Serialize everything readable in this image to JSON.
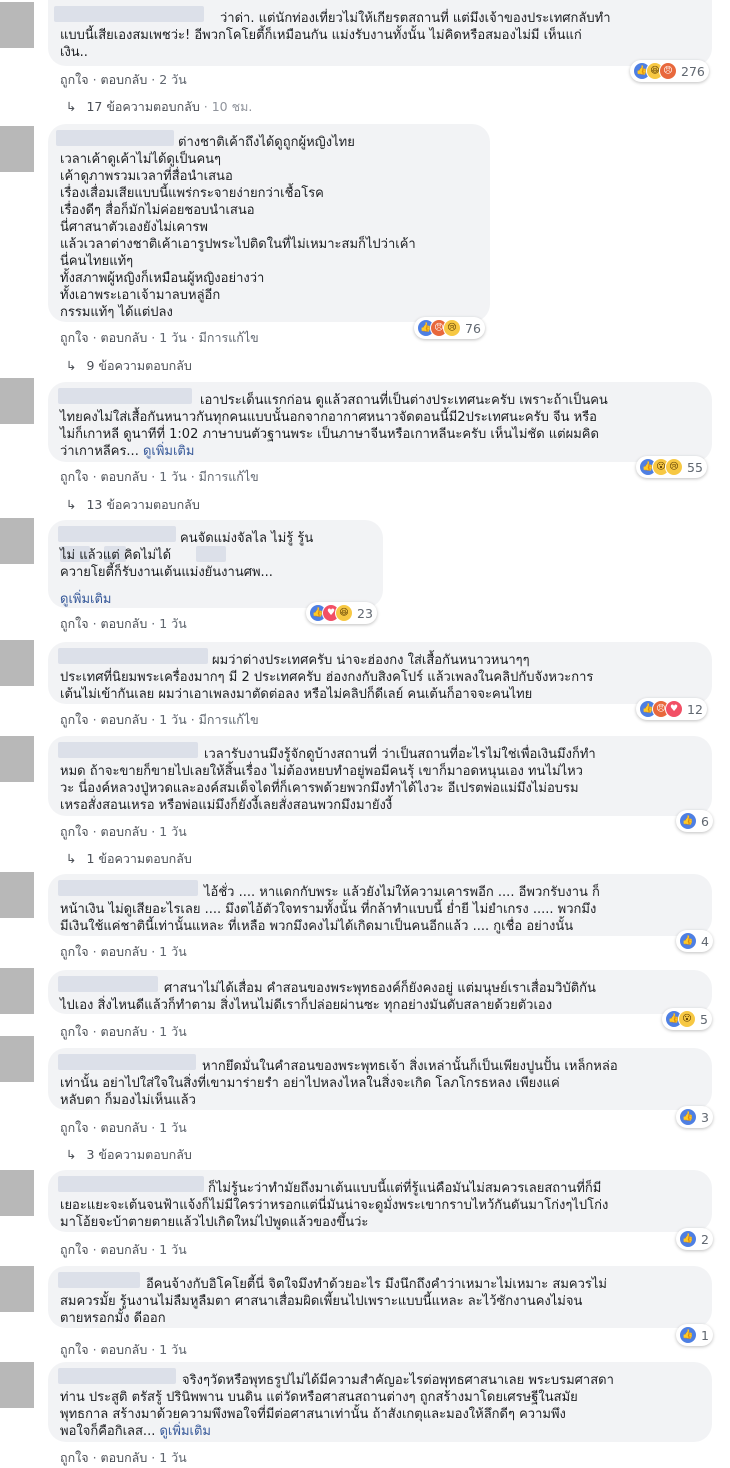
{
  "ui": {
    "like": "ถูกใจ",
    "reply": "ตอบกลับ",
    "edited": "มีการแก้ไข",
    "see_more": "ดูเพิ่มเติม",
    "sep": "·"
  },
  "comments": [
    {
      "text": "ว่าด่า. แต่นักท่องเที่ยวไม่ให้เกียรตสถานที่ แต่มึงเจ้าของประเทศกลับทำ\nแบบนี้เสียเองสมเพชว่ะ! อีพวกโคโยตี้ก็เหมือนกัน แม่งรับงานทั้งนั้น ไม่คิดหรือสมองไม่มี เห็นแก่\nเงิน..",
      "time": "2 วัน",
      "count": "276",
      "icons": [
        "like-icon",
        "haha-icon",
        "angry-icon"
      ],
      "replies": "17 ข้อความตอบกลับ",
      "reply_time": "10 ชม."
    },
    {
      "text": "ต่างชาติเค้าถึงได้ดูถูกผู้หญิงไทย\nเวลาเค้าดูเค้าไม่ได้ดูเป็นคนๆ\nเค้าดูภาพรวมเวลาที่สื่อนำเสนอ\nเรื่องเสื่อมเสียแบบนี้แพร่กระจายง่ายกว่าเชื้อโรค\nเรื่องดีๆ สื่อก็มักไม่ค่อยชอบนำเสนอ\nนี่ศาสนาตัวเองยังไม่เคารพ\nแล้วเวลาต่างชาติเค้าเอารูปพระไปติดในที่ไม่เหมาะสมก็ไปว่าเค้า\nนี่คนไทยแท้ๆ\nทั้งสภาพผู้หญิงก็เหมือนผู้หญิงอย่างว่า\nทั้งเอาพระเอาเจ้ามาลบหลู่อีก\nกรรมแท้ๆ ได้แต่ปลง",
      "time": "1 วัน",
      "count": "76",
      "icons": [
        "like-icon",
        "angry-icon",
        "sad-icon"
      ],
      "replies": "9 ข้อความตอบกลับ"
    },
    {
      "text": "เอาประเด็นแรกก่อน ดูแล้วสถานที่เป็นต่างประเทศนะครับ เพราะถ้าเป็นคน\nไทยคงไม่ใส่เสื้อกันหนาวกันทุกคนแบบนั้นอกจากอากาศหนาวจัดตอนนี้มี2ประเทศนะครับ จีน หรือ\nไม่ก็เกาหลี ดูนาทีที่ 1:02 ภาษาบนตัวฐานพระ เป็นภาษาจีนหรือเกาหลีนะครับ เห็นไม่ชัด แต่ผมคิด\nว่าเกาหลีคร...",
      "time": "1 วัน",
      "count": "55",
      "icons": [
        "like-icon",
        "wow-icon",
        "sad-icon"
      ],
      "replies": "13 ข้อความตอบกลับ"
    },
    {
      "text": "คนจัดแม่งจัลไล ไม่รู้ รู้น\nไม่ แล้วแต่ คิดไม่ได้\nควายโยตี้ก็รับงานเต้นแม่งยันงานศพ...",
      "time": "1 วัน",
      "count": "23",
      "icons": [
        "like-icon",
        "love-icon",
        "haha-icon"
      ]
    },
    {
      "text": "ผมว่าต่างประเทศครับ น่าจะฮ่องกง ใส่เสื้อกันหนาวหนาๆๆ\nประเทศที่นิยมพระเครื่องมากๆ มี 2 ประเทศครับ ฮ่องกงกับสิงคโปร์ แล้วเพลงในคลิปกับจังหวะการ\nเต้นไม่เข้ากันเลย ผมว่าเอาเพลงมาตัดต่อลง หรือไม่คลิปก็ดีเลย์ คนเต้นก็อาจจะคนไทย",
      "time": "1 วัน",
      "count": "12",
      "icons": [
        "like-icon",
        "angry-icon",
        "love-icon"
      ]
    },
    {
      "text": "เวลารับงานมึงรู้จักดูบ้างสถานที่ ว่าเป็นสถานที่อะไรไม่ใช่เพื่อเงินมึงก็ทำ\nหมด ถ้าจะขายก็ขายไปเลยให้สิ้นเรื่อง ไม่ต้องหยบทำอยู่พอมีคนรุ้ เขาก็มาอดหนุนเอง ทนไม่ไหว\nวะ นี่องค์หลวงปู่หวดและองค์สมเด็จไดที่ก็เคารพด้วยพวกมึงทำได้ไงวะ อีเปรตพ่อแม่มึงไม่อบรม\nเหรอสั่งสอนเหรอ หรือพ่อแม่มึงก็ยังงี้เลยสั่งสอนพวกมึงมายังงี้",
      "time": "1 วัน",
      "count": "6",
      "icons": [
        "like-icon"
      ],
      "replies": "1 ข้อความตอบกลับ"
    },
    {
      "text": "ไอ้ชั่ว .... หาแดกกับพระ แล้วยังไม่ให้ความเคารพอีก .... อีพวกรับงาน ก็\nหน้าเงิน ไม่ดูเสียอะไรเลย .... มึงตไอ้ตัวใจทรามทั้งนั้น ที่กล้าทำแบบนี้ ย่ำยี ไม่ยำเกรง ..... พวกมึง\nมีเงินใช้แค่ชาตินี้เท่านั้นแหละ ที่เหลือ พวกมึงคงไม่ได้เกิดมาเป็นคนอีกแล้ว .... กูเชื่อ อย่างนั้น",
      "time": "1 วัน",
      "count": "4",
      "icons": [
        "like-icon"
      ]
    },
    {
      "text": "ศาสนาไม่ได้เสื่อม คำสอนของพระพุทธองค์ก็ยังคงอยู่ แต่มนุษย์เราเสื่อมวิบัติกัน\nไปเอง สิ่งไหนดีแล้วก็ทำตาม สิ่งไหนไม่ดีเราก็ปล่อยผ่านซะ ทุกอย่างมันดับสลายด้วยตัวเอง",
      "time": "1 วัน",
      "count": "5",
      "icons": [
        "like-icon",
        "wow-icon"
      ]
    },
    {
      "text": "หากยึดมั่นในคำสอนของพระพุทธเจ้า สิ่งเหล่านั้นก็เป็นเพียงปูนปั้น เหล็กหล่อ\nเท่านั้น อย่าไปใส่ใจในสิ่งที่เขามาร่ายรำ อย่าไปหลงไหลในสิ่งจะเกิด โลภโกรธหลง เพียงแค่\nหลับตา ก็มองไม่เห็นแล้ว",
      "time": "1 วัน",
      "count": "3",
      "icons": [
        "like-icon"
      ],
      "replies": "3 ข้อความตอบกลับ"
    },
    {
      "text": "ก็ไม่รู้นะว่าทำมัยถึงมาเต้นแบบนี้แต่ที่รู้แน่คือมันไม่สมควรเลยสถานที่ก็มี\nเยอะแยะจะเต้นจนฟ้าแจ้งก็ไม่มีใครว่าหรอกแต่นี่มันน่าจะดูมั่งพระเขากราบไหว้กันดันมาโก่งๆไปโก่ง\nมาโอ้ยจะบ้าตายตายแล้วไปเกิดใหม่ไป่พูดแล้วของขึ้นว่ะ",
      "time": "1 วัน",
      "count": "2",
      "icons": [
        "like-icon"
      ]
    },
    {
      "text": "อีคนจ้างกับอิโคโยตี้นี่ จิตใจมึงทำด้วยอะไร มึงนึกถึงคำว่าเหมาะไม่เหมาะ สมควรไม่\nสมควรมั้ย รู้นงานไม่ลืมหูลืมตา ศาสนาเสื่อมผิดเพี้ยนไปเพราะแบบนี้แหละ ละไว้ซักงานคงไม่จน\nตายหรอกมั้ง ดีออก",
      "time": "1 วัน",
      "count": "1",
      "icons": [
        "like-icon"
      ]
    },
    {
      "text": "จริงๆวัดหรือพุทธรูปไม่ได้มีความสำคัญอะไรต่อพุทธศาสนาเลย พระบรมศาสดา\nท่าน ประสูติ ตรัสรู้ ปรินิพพาน บนดิน แต่วัดหรือศาสนสถานต่างๆ ถูกสร้างมาโดยเศรษฐีในสมัย\nพุทธกาล สร้างมาด้วยความพึงพอใจที่มีต่อศาสนาเท่านั้น ถ้าสังเกตุและมองให้ลึกดีๆ ความพึง\nพอใจก็คือกิเลส...",
      "time": "1 วัน"
    }
  ]
}
